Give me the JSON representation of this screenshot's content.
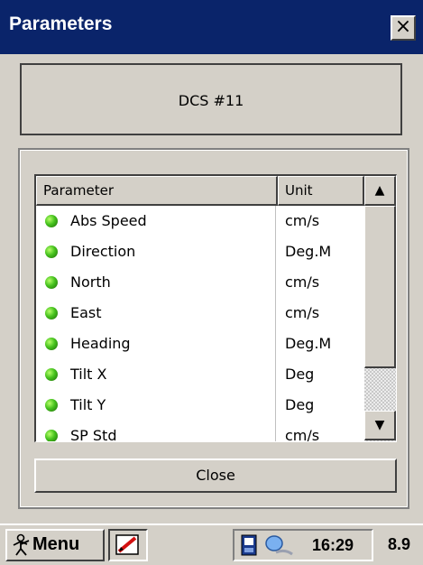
{
  "window": {
    "title": "Parameters",
    "close_glyph": "×"
  },
  "header_box": {
    "text": "DCS #11"
  },
  "table": {
    "columns": [
      "Parameter",
      "Unit"
    ],
    "rows": [
      {
        "parameter": "Abs Speed",
        "unit": "cm/s",
        "status": "green"
      },
      {
        "parameter": "Direction",
        "unit": "Deg.M",
        "status": "green"
      },
      {
        "parameter": "North",
        "unit": "cm/s",
        "status": "green"
      },
      {
        "parameter": "East",
        "unit": "cm/s",
        "status": "green"
      },
      {
        "parameter": "Heading",
        "unit": "Deg.M",
        "status": "green"
      },
      {
        "parameter": "Tilt X",
        "unit": "Deg",
        "status": "green"
      },
      {
        "parameter": "Tilt Y",
        "unit": "Deg",
        "status": "green"
      },
      {
        "parameter": "SP Std",
        "unit": "cm/s",
        "status": "green"
      }
    ],
    "scroll_up_glyph": "▲",
    "scroll_down_glyph": "▼"
  },
  "buttons": {
    "close": "Close"
  },
  "taskbar": {
    "menu": "Menu",
    "time": "16:29",
    "extra": "8.9",
    "icons": [
      "start-figure-icon",
      "pen-app-icon",
      "storage-card-icon",
      "network-icon"
    ]
  },
  "colors": {
    "titlebar": "#0a246a",
    "face": "#d4d0c8",
    "status_green": "#46c21e"
  }
}
